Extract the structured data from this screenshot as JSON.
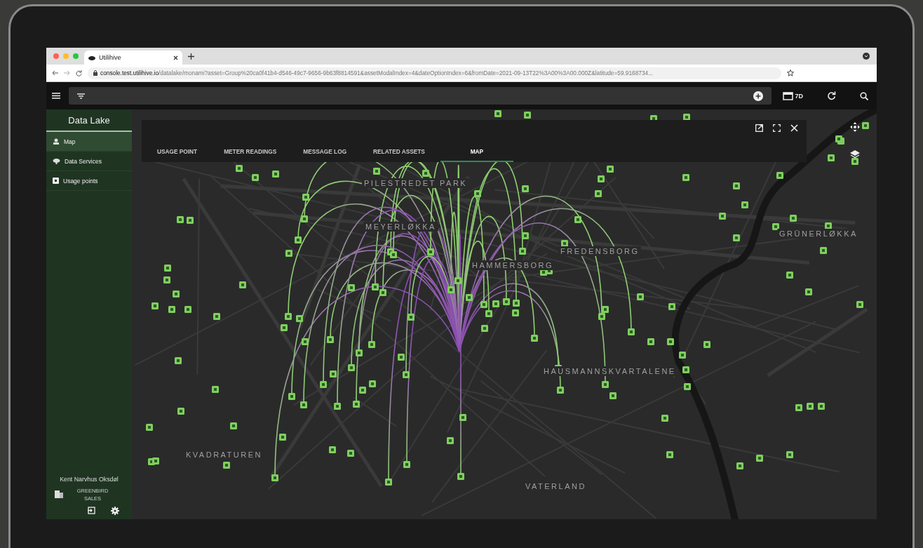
{
  "browser": {
    "tab_title": "Utilihive",
    "url_host": "console.test.utilihive.io",
    "url_path": "/datalake/monami?asset=Group%20ca0f41b4-d546-49c7-9656-9b63f8814591&assetModalIndex=4&dateOptionIndex=6&fromDate=2021-09-13T22%3A00%3A00.000Z&latitude=59.9168734..."
  },
  "toolbar": {
    "range": "7D"
  },
  "sidebar": {
    "title": "Data Lake",
    "items": [
      {
        "label": "Map",
        "kind": "map",
        "selected": true
      },
      {
        "label": "Data Services",
        "kind": "services",
        "selected": false
      },
      {
        "label": "Usage points",
        "kind": "points",
        "selected": false
      }
    ],
    "user": "Kent Narvhus Oksdøl",
    "org": "GREENBIRD SALES"
  },
  "panel": {
    "tabs": [
      {
        "label": "USAGE POINT",
        "selected": false
      },
      {
        "label": "METER READINGS",
        "selected": false
      },
      {
        "label": "MESSAGE LOG",
        "selected": false
      },
      {
        "label": "RELATED ASSETS",
        "selected": false
      },
      {
        "label": "MAP",
        "selected": true
      }
    ]
  },
  "map": {
    "districts": [
      "PILESTREDET PARK",
      "MEYERLØKKA",
      "HAMMERSBORG",
      "FREDENSBORG",
      "GRÜNERLØKKA",
      "HAUSMANNSKVARTALENE",
      "KVADRATUREN",
      "VATERLAND"
    ]
  }
}
